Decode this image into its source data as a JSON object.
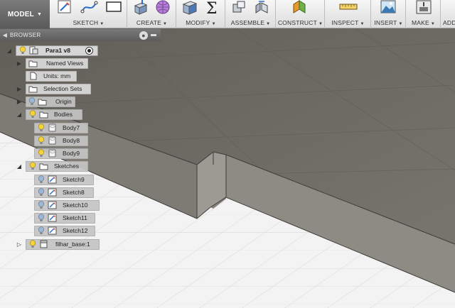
{
  "toolbar": {
    "mode": "MODEL",
    "groups": [
      {
        "label": "SKETCH"
      },
      {
        "label": "CREATE"
      },
      {
        "label": "MODIFY"
      },
      {
        "label": "ASSEMBLE"
      },
      {
        "label": "CONSTRUCT"
      },
      {
        "label": "INSPECT"
      },
      {
        "label": "INSERT"
      },
      {
        "label": "MAKE"
      },
      {
        "label": "ADD"
      }
    ]
  },
  "browser": {
    "title": "BROWSER",
    "root": {
      "label": "Para1 v8"
    },
    "items": [
      {
        "label": "Named Views"
      },
      {
        "label": "Units: mm"
      },
      {
        "label": "Selection Sets"
      },
      {
        "label": "Origin"
      },
      {
        "label": "Bodies"
      },
      {
        "label": "Body7"
      },
      {
        "label": "Body8"
      },
      {
        "label": "Body9"
      },
      {
        "label": "Sketches"
      },
      {
        "label": "Sketch9"
      },
      {
        "label": "Sketch8"
      },
      {
        "label": "Sketch10"
      },
      {
        "label": "Sketch11"
      },
      {
        "label": "Sketch12"
      },
      {
        "label": "filhar_base:1"
      }
    ]
  },
  "colors": {
    "model_top": "#696860",
    "model_front": "#8d8b84",
    "grid": "#d4d4d4",
    "bulb_on": "#f3d23a",
    "bulb_off": "#9fb7d6",
    "accent": "#3b7fd6"
  }
}
